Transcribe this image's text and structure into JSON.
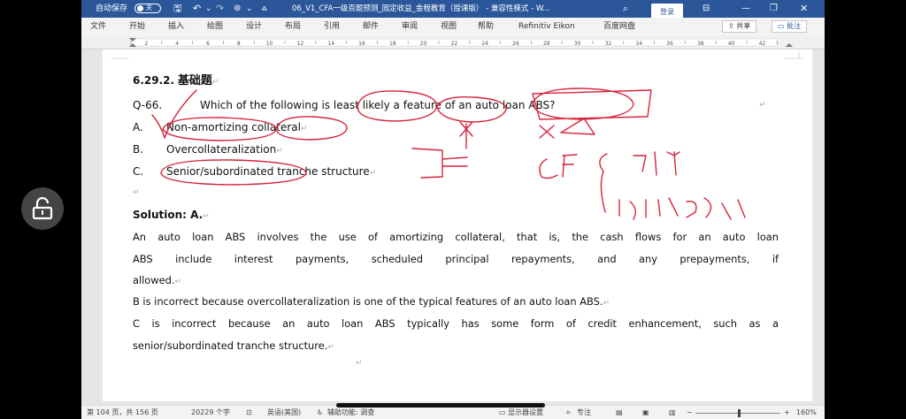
{
  "titlebar": {
    "autosave_label": "自动保存",
    "autosave_state": "关",
    "doc_title": "06_V1_CFA一级百题预测_固定收益_金程教育（授课版） - 兼容性模式 - W...",
    "login_label": "登录"
  },
  "menubar": {
    "items": [
      "文件",
      "开始",
      "插入",
      "绘图",
      "设计",
      "布局",
      "引用",
      "邮件",
      "审阅",
      "视图",
      "帮助",
      "Refinitiv Eikon",
      "百度网盘"
    ],
    "share_label": "共享",
    "comment_label": "批注"
  },
  "ruler": {
    "numbers": [
      "2",
      "4",
      "6",
      "8",
      "10",
      "12",
      "14",
      "16",
      "18",
      "20",
      "22",
      "24",
      "26",
      "28",
      "30",
      "32",
      "34",
      "36",
      "38",
      "40",
      "42"
    ]
  },
  "document": {
    "section_number": "6.29.2.",
    "section_title": "基础题",
    "question_number": "Q-66.",
    "question_text": "Which of the following is least likely a feature of an auto loan ABS?",
    "options": [
      {
        "letter": "A.",
        "text": "Non-amortizing collateral"
      },
      {
        "letter": "B.",
        "text": "Overcollateralization"
      },
      {
        "letter": "C.",
        "text": "Senior/subordinated tranche structure"
      }
    ],
    "solution_label": "Solution: A.",
    "explanation_lines": [
      "An auto loan ABS involves the use of amortizing collateral, that is, the cash flows for an auto loan",
      "ABS include interest payments, scheduled principal repayments, and any prepayments, if",
      "allowed."
    ],
    "b_line": "B is incorrect because overcollateralization is one of the typical features of an auto loan ABS.",
    "c_lines": [
      "C is incorrect because an auto loan ABS typically has some form of credit enhancement, such as a",
      "senior/subordinated tranche structure."
    ],
    "paragraph_mark": "↵"
  },
  "statusbar": {
    "page_info": "第 104 页，共 156 页",
    "word_count": "20229 个字",
    "language": "英语(美国)",
    "accessibility": "辅助功能: 调查",
    "display_settings": "显示器设置",
    "focus": "专注",
    "zoom": "160%",
    "zoom_minus": "−",
    "zoom_plus": "+"
  },
  "colors": {
    "titlebar_bg": "#2b579a",
    "ink": "#d6243a"
  }
}
